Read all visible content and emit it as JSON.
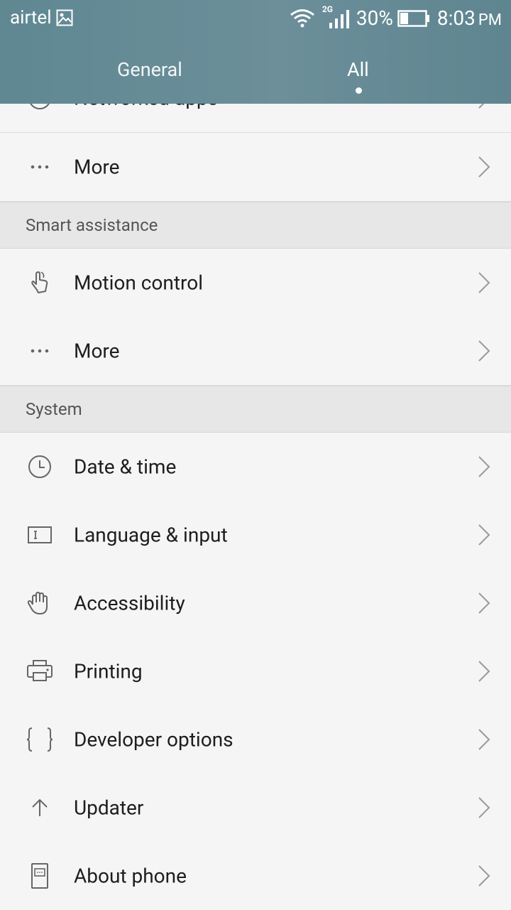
{
  "status_bar": {
    "carrier": "airtel",
    "network": "2G",
    "battery": "30%",
    "time": "8:03",
    "ampm": "PM"
  },
  "tabs": [
    {
      "label": "General"
    },
    {
      "label": "All"
    }
  ],
  "rows": {
    "partial": {
      "label": "Networked apps"
    },
    "more1": {
      "label": "More"
    },
    "motion": {
      "label": "Motion control"
    },
    "more2": {
      "label": "More"
    },
    "date": {
      "label": "Date & time"
    },
    "language": {
      "label": "Language & input"
    },
    "accessibility": {
      "label": "Accessibility"
    },
    "printing": {
      "label": "Printing"
    },
    "developer": {
      "label": "Developer options"
    },
    "updater": {
      "label": "Updater"
    },
    "about": {
      "label": "About phone"
    }
  },
  "sections": {
    "smart": "Smart assistance",
    "system": "System"
  },
  "colors": {
    "header": "#66909a",
    "background": "#f5f5f5",
    "section": "#e7e7e7"
  }
}
